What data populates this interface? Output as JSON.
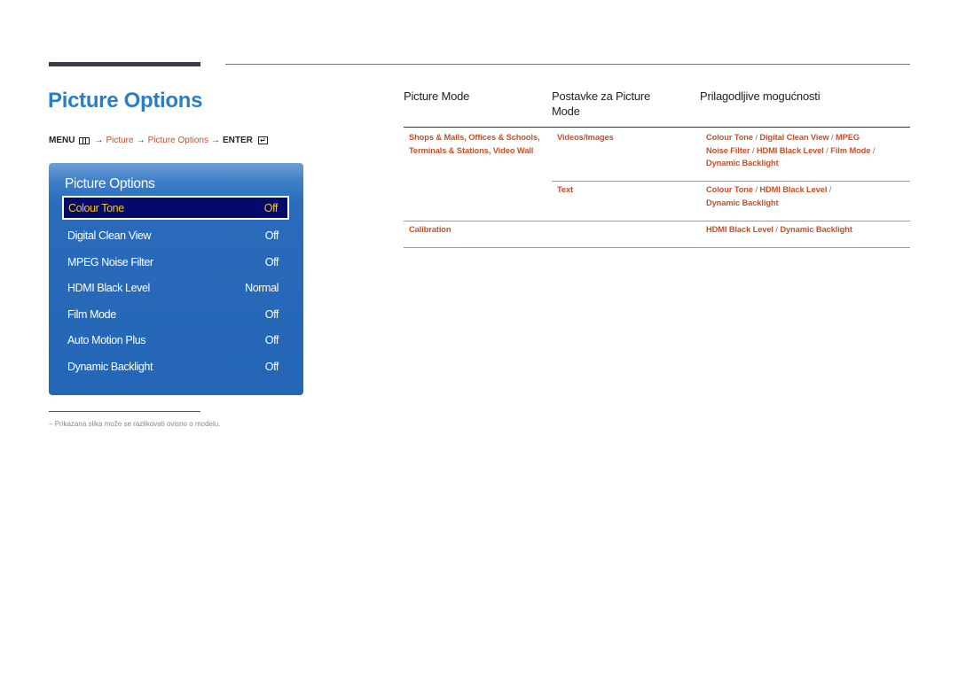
{
  "page": {
    "title": "Picture Options",
    "menu_path": {
      "menu_label": "MENU",
      "arrow": "→",
      "step1": "Picture",
      "step2": "Picture Options",
      "enter_label": "ENTER",
      "menu_icon": "menu-grid-icon",
      "enter_icon": "enter-icon"
    },
    "footnote": {
      "dash": "–",
      "text": "Prikazana slika može se razlikovati ovisno o modelu."
    }
  },
  "osd": {
    "title": "Picture Options",
    "items": [
      {
        "label": "Colour Tone",
        "value": "Off",
        "selected": true
      },
      {
        "label": "Digital Clean View",
        "value": "Off"
      },
      {
        "label": "MPEG Noise Filter",
        "value": "Off"
      },
      {
        "label": "HDMI Black Level",
        "value": "Normal"
      },
      {
        "label": "Film Mode",
        "value": "Off"
      },
      {
        "label": "Auto Motion Plus",
        "value": "Off"
      },
      {
        "label": "Dynamic Backlight",
        "value": "Off"
      }
    ],
    "colors": {
      "panel": "#2466b6",
      "selected_bg": "#05096a",
      "selected_text": "#f3c42e"
    }
  },
  "table": {
    "headers": [
      "Picture Mode",
      "Postavke za Picture Mode",
      "Prilagodljive mogućnosti"
    ],
    "rows": [
      {
        "mode_line1": "Shops & Malls, Offices & Schools,",
        "mode_line2": "Terminals & Stations, Video Wall",
        "setting": "Videos/Images",
        "options_line1": [
          "Colour Tone",
          "Digital Clean View",
          "MPEG"
        ],
        "options_line2": [
          "Noise Filter",
          "HDMI Black Level",
          "Film Mode"
        ],
        "options_line3": [
          "Dynamic Backlight"
        ]
      },
      {
        "mode_line1": "",
        "setting": "Text",
        "options_line1": [
          "Colour Tone",
          "HDMI Black Level"
        ],
        "options_line2": [
          "Dynamic Backlight"
        ]
      },
      {
        "mode_line1": "Calibration",
        "setting": "",
        "options_line1": [
          "HDMI Black Level",
          "Dynamic Backlight"
        ]
      }
    ],
    "separator": "/",
    "link_color": "#c4512a"
  }
}
